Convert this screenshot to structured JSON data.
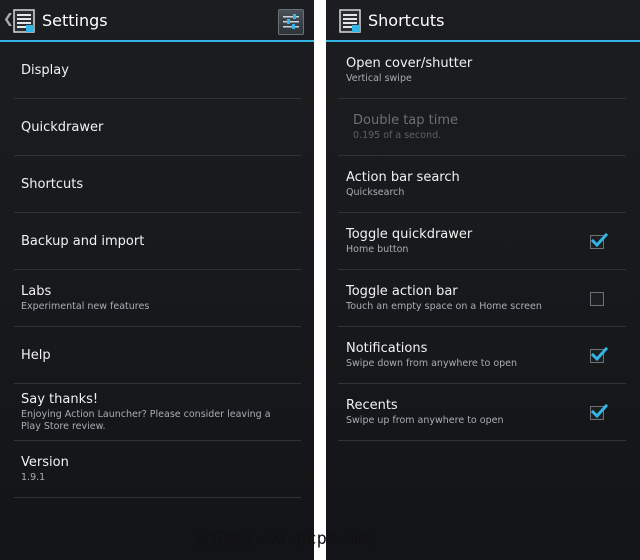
{
  "settings": {
    "title": "Settings",
    "back_glyph": "❮",
    "icons": {
      "app": "app-list-icon",
      "action": "settings-sliders-icon"
    },
    "items": [
      {
        "title": "Display",
        "subtitle": ""
      },
      {
        "title": "Quickdrawer",
        "subtitle": ""
      },
      {
        "title": "Shortcuts",
        "subtitle": ""
      },
      {
        "title": "Backup and import",
        "subtitle": ""
      },
      {
        "title": "Labs",
        "subtitle": "Experimental new features"
      },
      {
        "title": "Help",
        "subtitle": ""
      },
      {
        "title": "Say thanks!",
        "subtitle": "Enjoying Action Launcher? Please consider leaving a Play Store review."
      },
      {
        "title": "Version",
        "subtitle": "1.9.1"
      }
    ]
  },
  "shortcuts": {
    "title": "Shortcuts",
    "items": [
      {
        "title": "Open cover/shutter",
        "subtitle": "Vertical swipe"
      },
      {
        "title": "Double tap time",
        "subtitle": "0.195 of a second.",
        "enabled": false
      },
      {
        "title": "Action bar search",
        "subtitle": "Quicksearch"
      },
      {
        "title": "Toggle quickdrawer",
        "subtitle": "Home button",
        "checked": true
      },
      {
        "title": "Toggle action bar",
        "subtitle": "Touch an empty space on a Home screen",
        "checked": false
      },
      {
        "title": "Notifications",
        "subtitle": "Swipe down from anywhere to open",
        "checked": true
      },
      {
        "title": "Recents",
        "subtitle": "Swipe up from anywhere to open",
        "checked": true
      }
    ]
  },
  "colors": {
    "accent": "#33b5e5",
    "background": "#16181b",
    "divider": "#2f3236"
  },
  "watermark": "双电网(www.pcpc.me)"
}
